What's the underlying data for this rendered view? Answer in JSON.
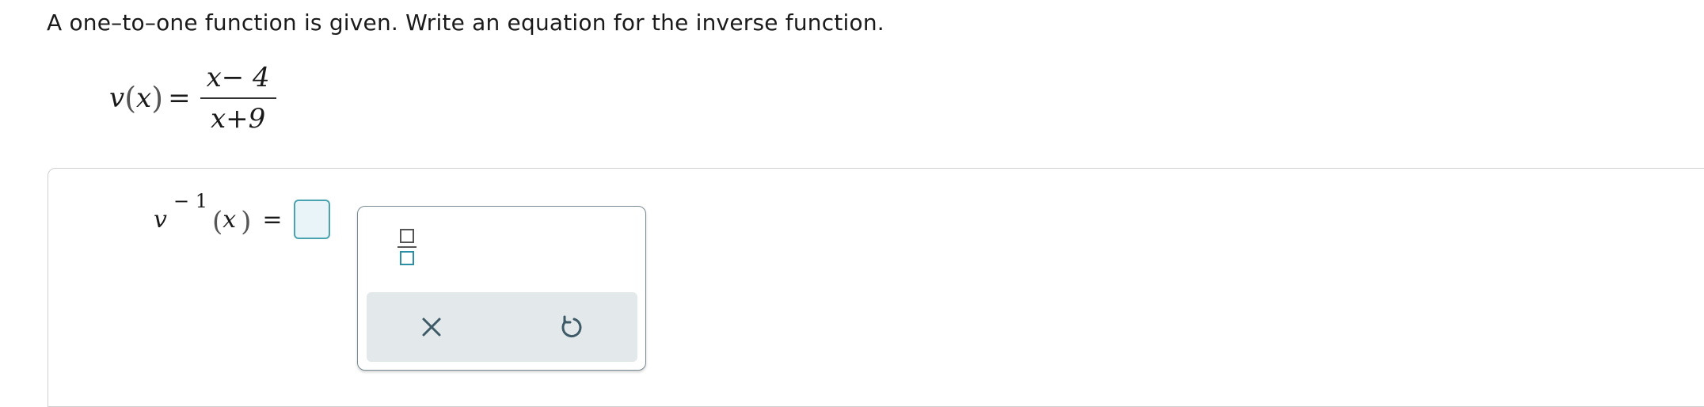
{
  "question": {
    "prompt": "A one–to–one function is given. Write an equation for the inverse function."
  },
  "given_function": {
    "name": "v",
    "variable": "x",
    "equals": "=",
    "numerator": "x− 4",
    "denominator": "x+9"
  },
  "answer": {
    "name": "v",
    "exponent": "− 1",
    "variable": "x",
    "equals": "=",
    "value": ""
  },
  "palette": {
    "tools": [
      {
        "id": "fraction",
        "icon": "fraction-template-icon"
      }
    ],
    "actions": [
      {
        "id": "clear",
        "icon": "close-icon"
      },
      {
        "id": "undo",
        "icon": "undo-icon"
      }
    ]
  },
  "colors": {
    "accent": "#2b8fa8",
    "input_border": "#4aa3b0",
    "input_fill": "#e8f4f7",
    "action_bar": "#e3e8eb",
    "icon": "#3d5a66"
  }
}
